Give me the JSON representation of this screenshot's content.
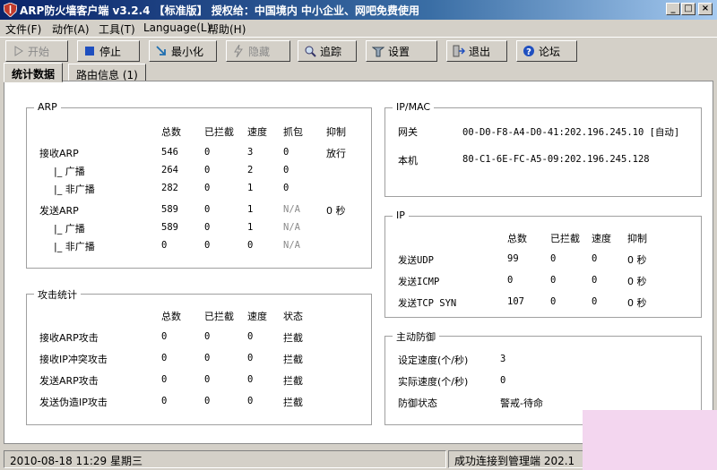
{
  "window": {
    "title": "ARP防火墙客户端 v3.2.4 【标准版】 授权给：中国境内 中小企业、网吧免费使用",
    "buttons": [
      "_",
      "□",
      "×"
    ]
  },
  "menu": [
    "文件(F)",
    "动作(A)",
    "工具(T)",
    "Language(L)",
    "帮助(H)"
  ],
  "toolbar": {
    "start": "开始",
    "stop": "停止",
    "minimize": "最小化",
    "hide": "隐藏",
    "trace": "追踪",
    "settings": "设置",
    "exit": "退出",
    "forum": "论坛"
  },
  "tabs": [
    "统计数据",
    "路由信息 (1)"
  ],
  "arp": {
    "legend": "ARP",
    "headers": [
      "总数",
      "已拦截",
      "速度",
      "抓包",
      "抑制"
    ],
    "rows": [
      {
        "label": "接收ARP",
        "cells": [
          "546",
          "0",
          "3",
          "0",
          "放行"
        ]
      },
      {
        "label": "|_ 广播",
        "cells": [
          "264",
          "0",
          "2",
          "0",
          ""
        ]
      },
      {
        "label": "|_ 非广播",
        "cells": [
          "282",
          "0",
          "1",
          "0",
          ""
        ]
      },
      {
        "label": "发送ARP",
        "cells": [
          "589",
          "0",
          "1",
          "N/A",
          "0 秒"
        ]
      },
      {
        "label": "|_ 广播",
        "cells": [
          "589",
          "0",
          "1",
          "N/A",
          ""
        ]
      },
      {
        "label": "|_ 非广播",
        "cells": [
          "0",
          "0",
          "0",
          "N/A",
          ""
        ]
      }
    ]
  },
  "attack": {
    "legend": "攻击统计",
    "headers": [
      "总数",
      "已拦截",
      "速度",
      "状态"
    ],
    "rows": [
      {
        "label": "接收ARP攻击",
        "cells": [
          "0",
          "0",
          "0",
          "拦截"
        ]
      },
      {
        "label": "接收IP冲突攻击",
        "cells": [
          "0",
          "0",
          "0",
          "拦截"
        ]
      },
      {
        "label": "发送ARP攻击",
        "cells": [
          "0",
          "0",
          "0",
          "拦截"
        ]
      },
      {
        "label": "发送伪造IP攻击",
        "cells": [
          "0",
          "0",
          "0",
          "拦截"
        ]
      }
    ]
  },
  "ipmac": {
    "legend": "IP/MAC",
    "gateway_label": "网关",
    "gateway_value": "00-D0-F8-A4-D0-41:202.196.245.10 [自动]",
    "local_label": "本机",
    "local_value": "80-C1-6E-FC-A5-09:202.196.245.128"
  },
  "ip": {
    "legend": "IP",
    "headers": [
      "总数",
      "已拦截",
      "速度",
      "抑制"
    ],
    "rows": [
      {
        "label": "发送UDP",
        "cells": [
          "99",
          "0",
          "0",
          "0 秒"
        ]
      },
      {
        "label": "发送ICMP",
        "cells": [
          "0",
          "0",
          "0",
          "0 秒"
        ]
      },
      {
        "label": "发送TCP SYN",
        "cells": [
          "107",
          "0",
          "0",
          "0 秒"
        ]
      }
    ]
  },
  "defense": {
    "legend": "主动防御",
    "set_speed_label": "设定速度(个/秒)",
    "set_speed_value": "3",
    "actual_speed_label": "实际速度(个/秒)",
    "actual_speed_value": "0",
    "status_label": "防御状态",
    "status_value": "警戒-待命"
  },
  "status": {
    "datetime": "2010-08-18 11:29 星期三",
    "connection": "成功连接到管理端 202.1"
  },
  "colors": {
    "titlebar_start": "#0a246a",
    "titlebar_end": "#a6caf0",
    "face": "#d4d0c8"
  }
}
